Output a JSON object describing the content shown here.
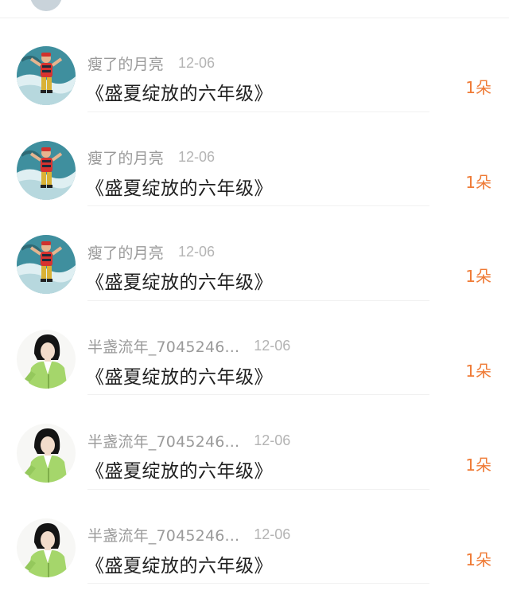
{
  "rows": [
    {
      "name": "瘦了的月亮",
      "date": "12-06",
      "title": "《盛夏绽放的六年级》",
      "count": "1朵",
      "avatar_icon": "avatar-rafting-photo"
    },
    {
      "name": "瘦了的月亮",
      "date": "12-06",
      "title": "《盛夏绽放的六年级》",
      "count": "1朵",
      "avatar_icon": "avatar-rafting-photo"
    },
    {
      "name": "瘦了的月亮",
      "date": "12-06",
      "title": "《盛夏绽放的六年级》",
      "count": "1朵",
      "avatar_icon": "avatar-rafting-photo"
    },
    {
      "name": "半盏流年_7045246...",
      "date": "12-06",
      "title": "《盛夏绽放的六年级》",
      "count": "1朵",
      "avatar_icon": "avatar-girl-green-jacket"
    },
    {
      "name": "半盏流年_7045246...",
      "date": "12-06",
      "title": "《盛夏绽放的六年级》",
      "count": "1朵",
      "avatar_icon": "avatar-girl-green-jacket"
    },
    {
      "name": "半盏流年_7045246...",
      "date": "12-06",
      "title": "《盛夏绽放的六年级》",
      "count": "1朵",
      "avatar_icon": "avatar-girl-green-jacket"
    }
  ],
  "colors": {
    "name": "#9a9a9a",
    "date": "#b4b4b4",
    "title": "#1f1f1f",
    "count": "#ef7a35"
  }
}
